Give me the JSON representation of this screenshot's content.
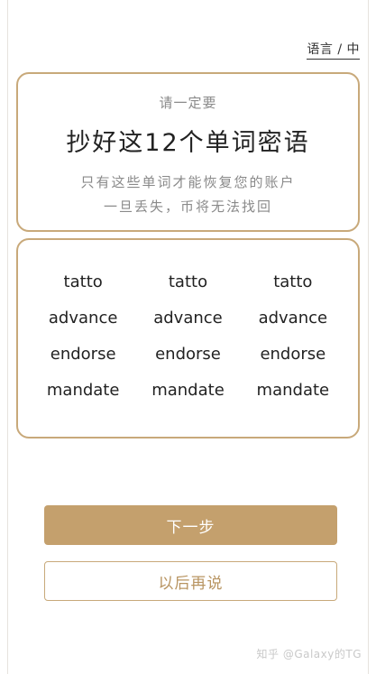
{
  "header": {
    "language_link": "语言 / 中"
  },
  "warning_card": {
    "subtitle": "请一定要",
    "title": "抄好这12个单词密语",
    "line1": "只有这些单词才能恢复您的账户",
    "line2": "一旦丢失，币将无法找回"
  },
  "words": [
    "tatto",
    "tatto",
    "tatto",
    "advance",
    "advance",
    "advance",
    "endorse",
    "endorse",
    "endorse",
    "mandate",
    "mandate",
    "mandate"
  ],
  "buttons": {
    "next_label": "下一步",
    "later_label": "以后再说"
  },
  "watermark": "知乎 @Galaxy的TG",
  "colors": {
    "accent": "#c4a06d",
    "border": "#c8a97a",
    "background": "#ffffff",
    "muted_text": "#8a8a8a",
    "dark_text": "#222222"
  }
}
